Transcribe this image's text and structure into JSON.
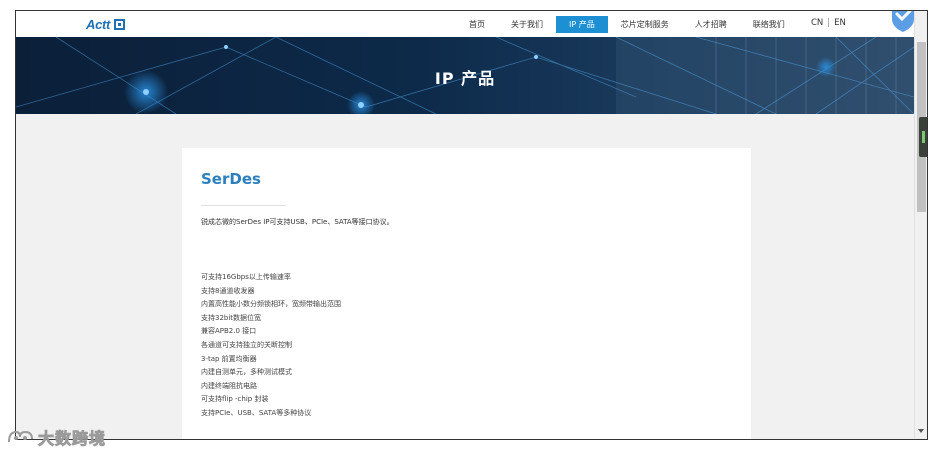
{
  "header": {
    "logo_text": "Actt",
    "nav": [
      "首页",
      "关于我们",
      "IP 产品",
      "芯片定制服务",
      "人才招聘",
      "联络我们"
    ],
    "active_nav": 2,
    "lang_cn": "CN",
    "lang_sep": "|",
    "lang_en": "EN"
  },
  "banner": {
    "title": "IP 产品"
  },
  "product": {
    "title": "SerDes",
    "intro": "锐成芯微的SerDes IP可支持USB、PCIe、SATA等接口协议。",
    "features": [
      "可支持16Gbps以上传输速率",
      "支持8通道收发器",
      "内置高性能小数分频锁相环，宽频带输出范围",
      "支持32bit数据位宽",
      "兼容APB2.0 接口",
      "各通道可支持独立的关断控制",
      "3-tap 前置均衡器",
      "内建自测单元，多种测试模式",
      "内建终端阻抗电路",
      "可支持flip -chip 封装",
      "支持PCIe、USB、SATA等多种协议"
    ]
  },
  "watermark": {
    "text": "大数跨境"
  },
  "colors": {
    "accent": "#1d8fd3",
    "title_blue": "#2b7fbf",
    "banner_bg": "#0a1a2e",
    "page_bg": "#f1f1f1"
  }
}
